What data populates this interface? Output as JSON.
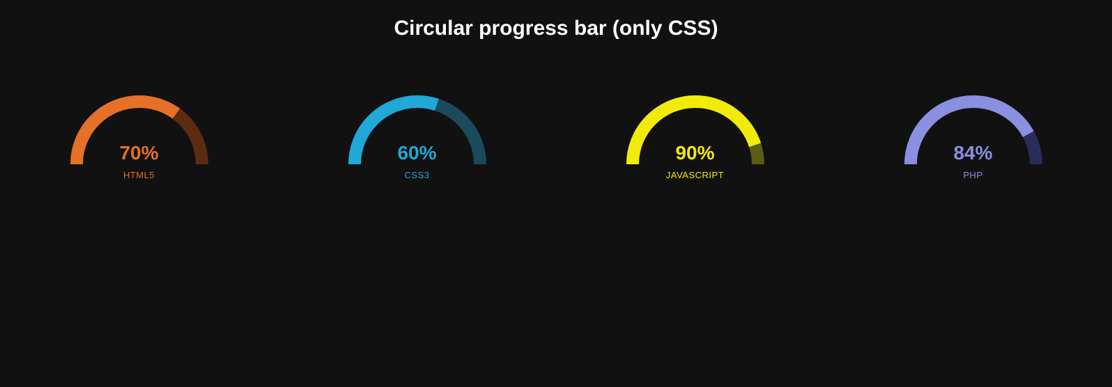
{
  "title": "Circular progress bar (only CSS)",
  "chart_data": {
    "type": "bar",
    "categories": [
      "HTML5",
      "CSS3",
      "JAVASCRIPT",
      "PHP"
    ],
    "values": [
      70,
      60,
      90,
      84
    ],
    "title": "Circular progress bar (only CSS)",
    "xlabel": "",
    "ylabel": "",
    "ylim": [
      0,
      100
    ]
  },
  "gauges": [
    {
      "percent": 70,
      "display": "70%",
      "label": "HTML5",
      "track": "#5c2b14",
      "fill": "#e67028",
      "text": "#e67028"
    },
    {
      "percent": 60,
      "display": "60%",
      "label": "CSS3",
      "track": "#1a4a5c",
      "fill": "#1fa8d8",
      "text": "#1fa8d8"
    },
    {
      "percent": 90,
      "display": "90%",
      "label": "JAVASCRIPT",
      "track": "#5c5c14",
      "fill": "#f2ea0a",
      "text": "#f2ea0a"
    },
    {
      "percent": 84,
      "display": "84%",
      "label": "PHP",
      "track": "#2a2d5c",
      "fill": "#8a8fe0",
      "text": "#8a8fe0"
    }
  ]
}
